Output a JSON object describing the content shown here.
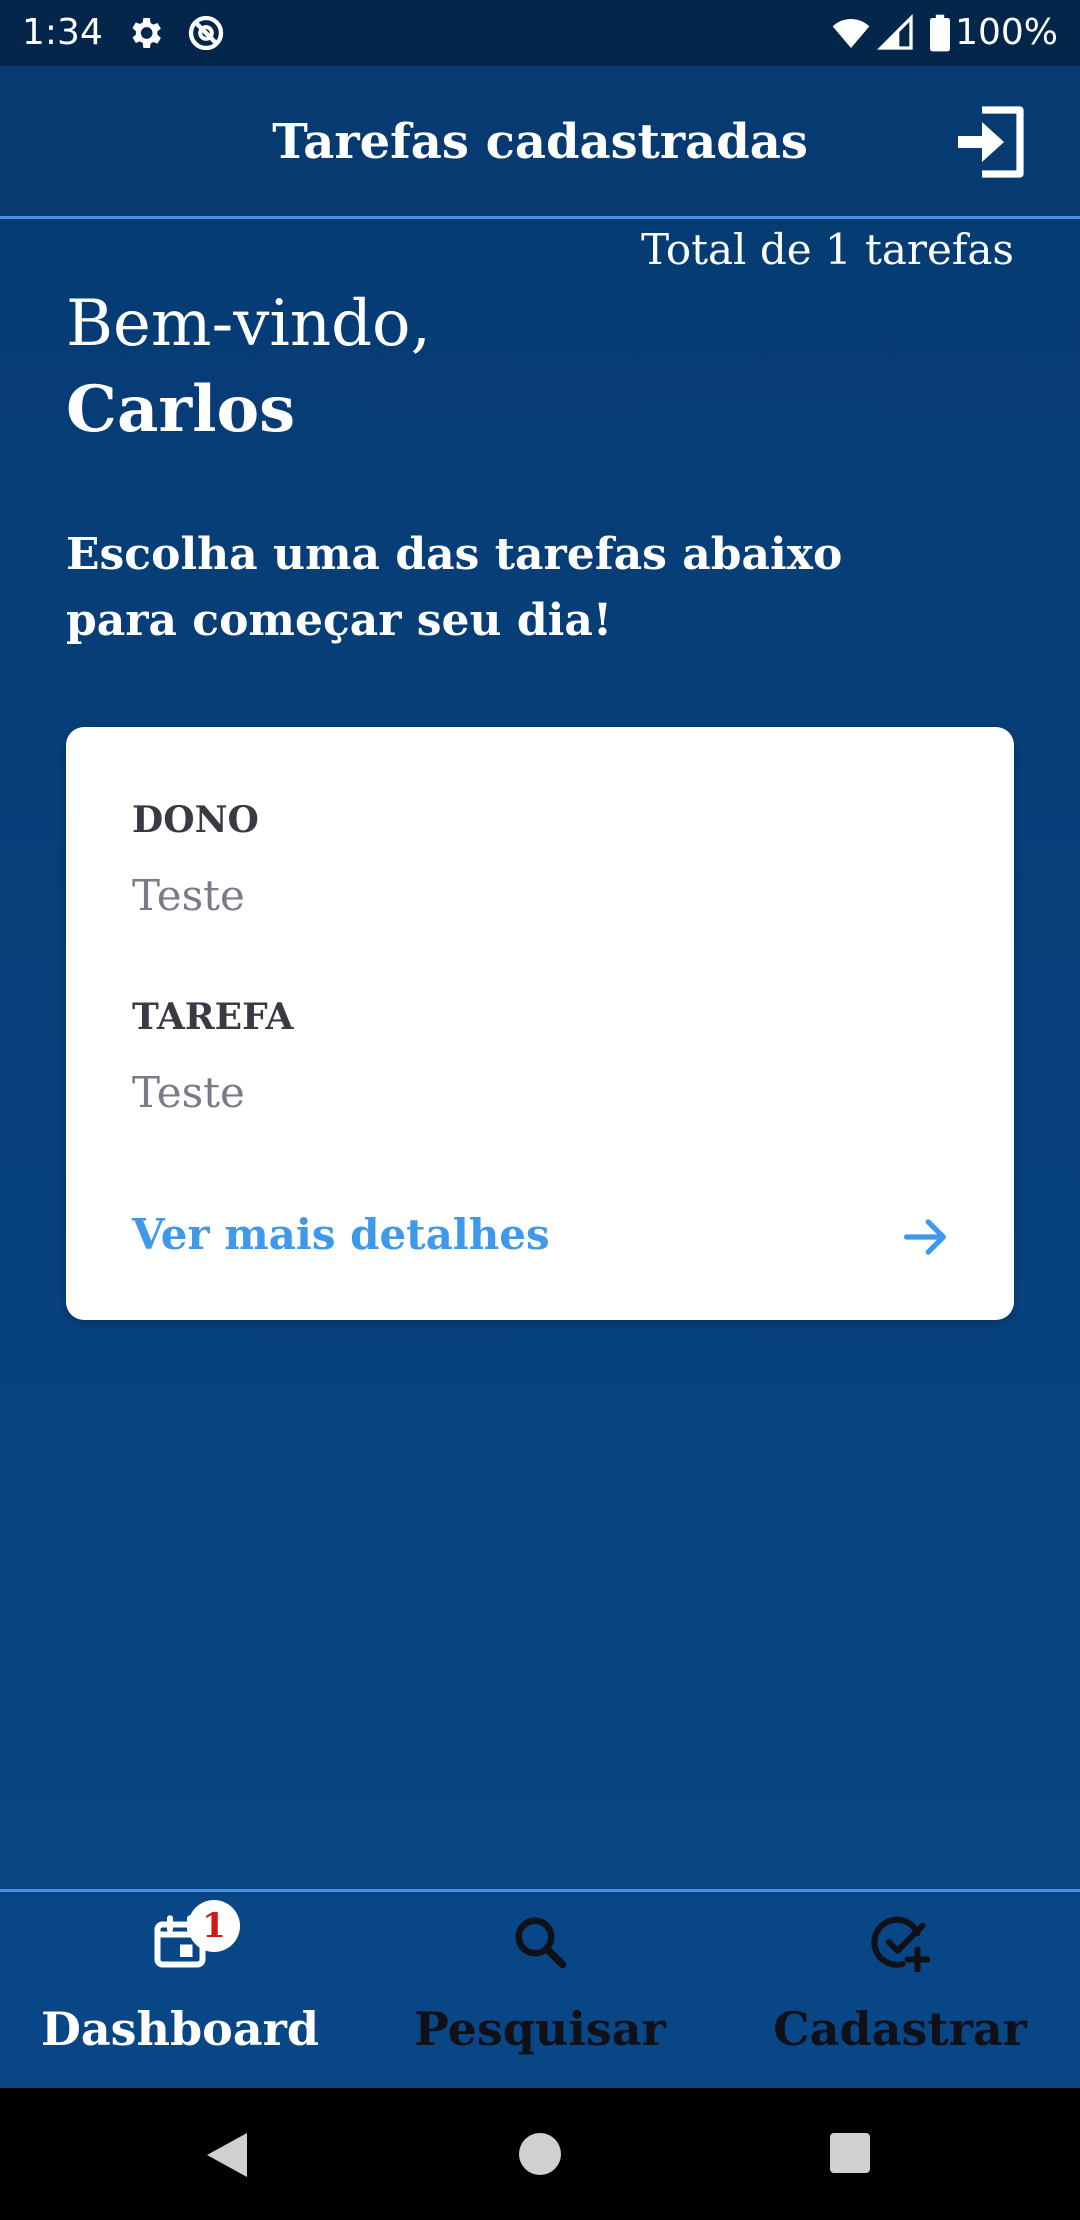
{
  "status_bar": {
    "time": "1:34",
    "battery_text": "100%"
  },
  "header": {
    "title": "Tarefas cadastradas",
    "logout_icon": "logout-icon"
  },
  "summary": {
    "total_text": "Total de 1 tarefas"
  },
  "welcome": {
    "greeting": "Bem-vindo,",
    "name": "Carlos",
    "subtitle": "Escolha uma das tarefas abaixo para começar seu dia!"
  },
  "tasks": [
    {
      "owner_label": "DONO",
      "owner_value": "Teste",
      "task_label": "TAREFA",
      "task_value": "Teste",
      "details_label": "Ver mais detalhes"
    }
  ],
  "bottom_nav": {
    "items": [
      {
        "label": "Dashboard",
        "icon": "calendar-icon",
        "badge": "1",
        "active": true
      },
      {
        "label": "Pesquisar",
        "icon": "search-icon",
        "active": false
      },
      {
        "label": "Cadastrar",
        "icon": "check-circle-add-icon",
        "active": false
      }
    ]
  },
  "colors": {
    "background": "#063a72",
    "header": "#063a70",
    "accent": "#4a90e2",
    "link": "#3f98ea",
    "card": "#ffffff",
    "badge_text": "#d01818"
  }
}
